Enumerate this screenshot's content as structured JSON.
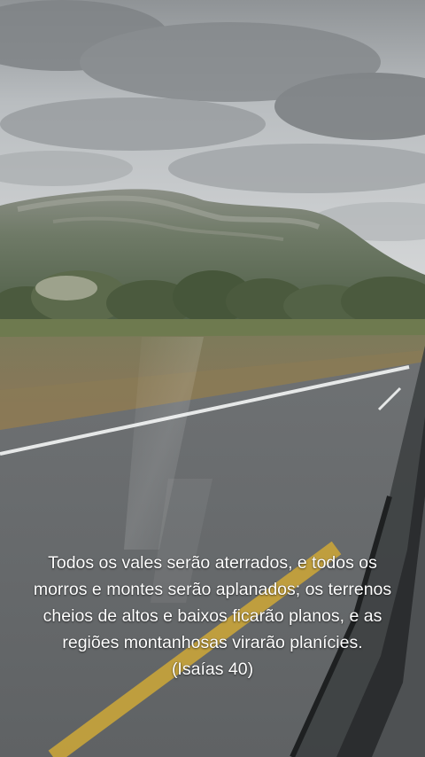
{
  "caption": {
    "lines": [
      "Todos os vales serão aterrados, e todos os",
      "morros e montes serão aplanados; os terrenos",
      "cheios de altos e baixos ficarão planos, e as",
      "regiões montanhosas virarão planícies.",
      "(Isaías 40)"
    ]
  },
  "scene": {
    "subjects": [
      "cloudy-sky",
      "mountain-ridge",
      "trees",
      "dry-field",
      "asphalt-road",
      "car-window-frame"
    ],
    "colors": {
      "sky": "#c9cdd0",
      "clouds": "#8d9194",
      "mountain": "#5e6c55",
      "field": "#8a7a5c",
      "road": "#707375",
      "lane_line_white": "#e8eaea",
      "lane_line_yellow": "#c9a43a",
      "window_frame": "#2b2d2f"
    }
  }
}
